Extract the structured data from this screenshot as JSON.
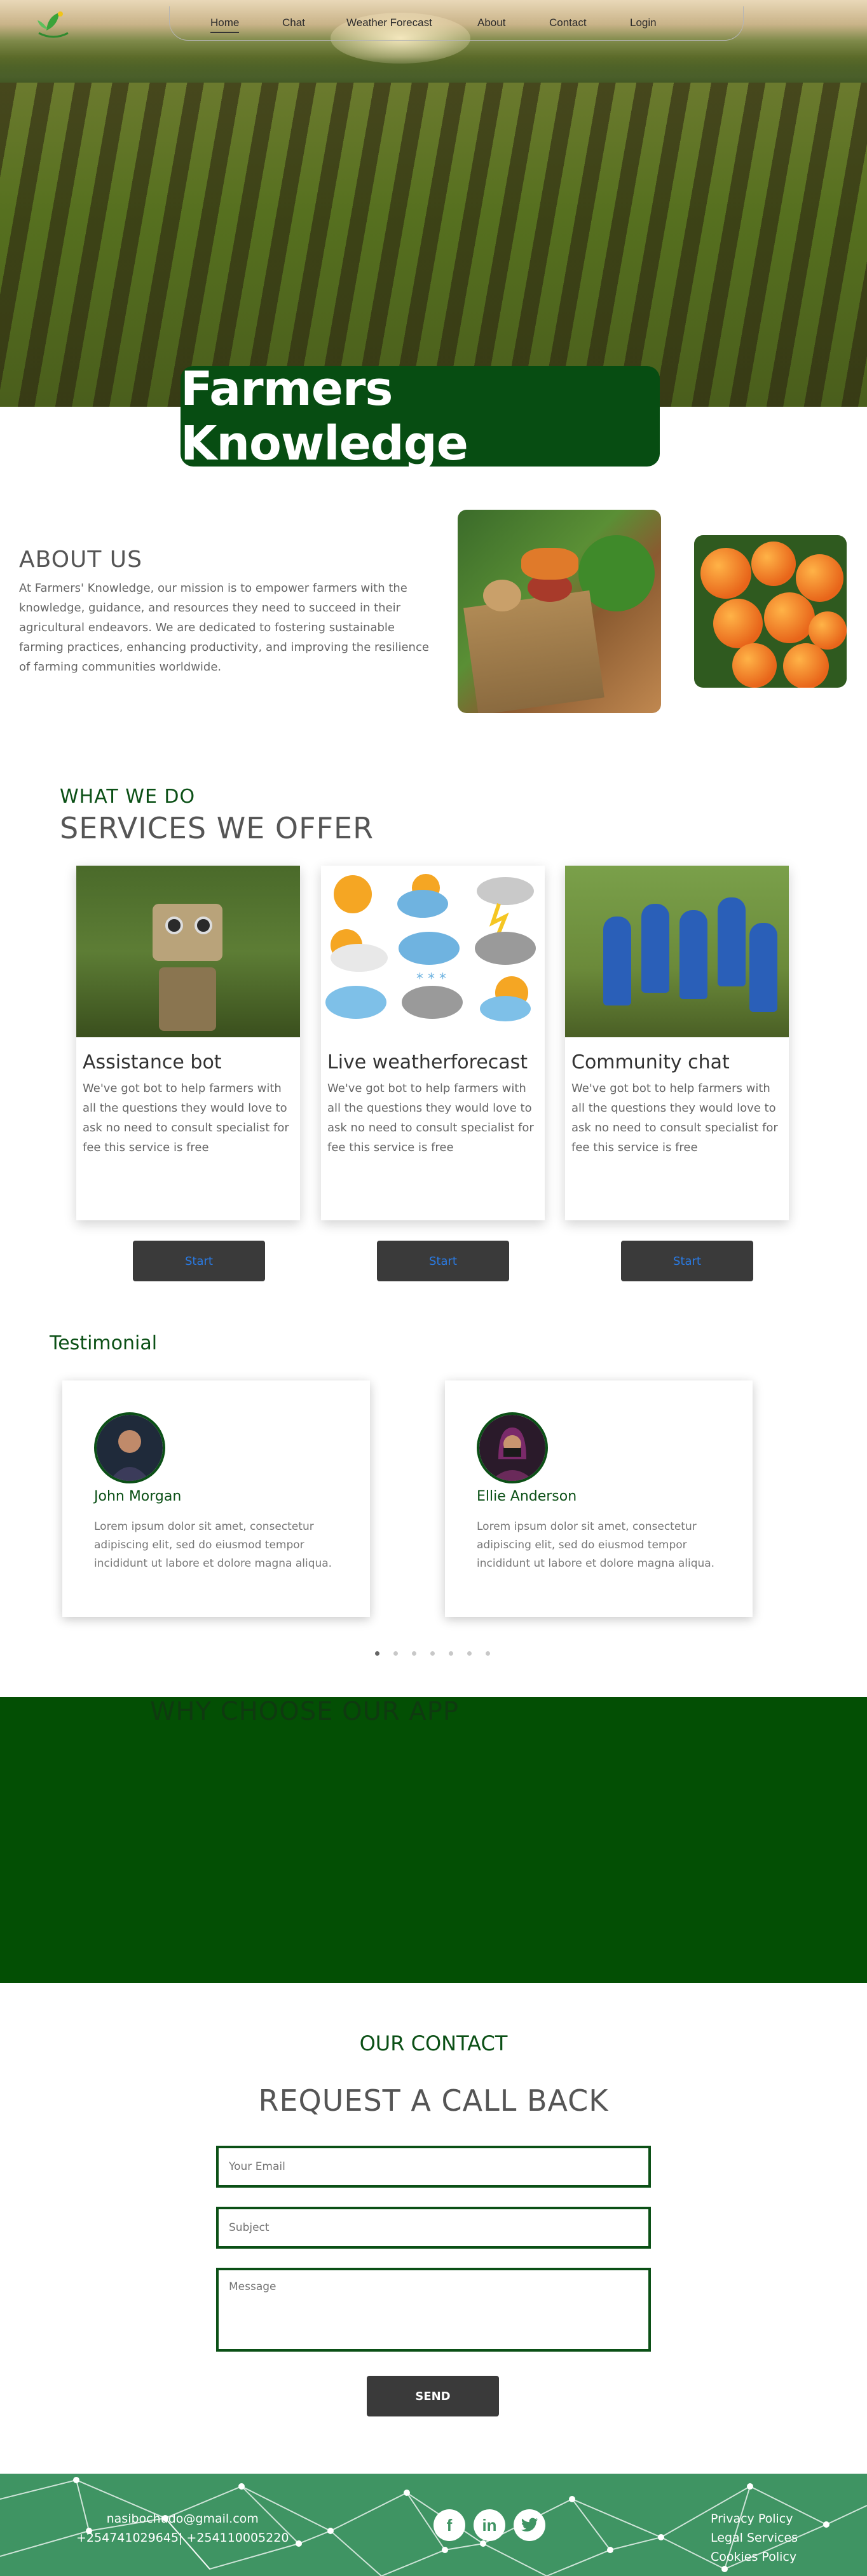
{
  "nav": {
    "items": [
      "Home",
      "Chat",
      "Weather Forecast",
      "About",
      "Contact",
      "Login"
    ],
    "active": "Home"
  },
  "hero": {
    "title": "Farmers Knowledge"
  },
  "about": {
    "heading": "ABOUT US",
    "text": "At Farmers' Knowledge, our mission is to empower farmers with the knowledge, guidance, and resources they need to succeed in their agricultural endeavors. We are dedicated to fostering sustainable farming practices, enhancing productivity, and improving the resilience of farming communities worldwide."
  },
  "services": {
    "kicker": "WHAT WE DO",
    "heading": "SERVICES WE OFFER",
    "cards": [
      {
        "title": "Assistance bot",
        "text": "We've got bot to help farmers with all the questions they would love to ask no need to consult specialist for fee this service is free",
        "button": "Start"
      },
      {
        "title": "Live weatherforecast",
        "text": "We've got bot to help farmers with all the questions they would love to ask no need to consult specialist for fee this service is free",
        "button": "Start"
      },
      {
        "title": "Community chat",
        "text": "We've got bot to help farmers with all the questions they would love to ask no need to consult specialist for fee this service is free",
        "button": "Start"
      }
    ]
  },
  "testimonial": {
    "heading": "Testimonial",
    "items": [
      {
        "name": "John Morgan",
        "text": "Lorem ipsum dolor sit amet, consectetur adipiscing elit, sed do eiusmod tempor incididunt ut labore et dolore magna aliqua."
      },
      {
        "name": "Ellie Anderson",
        "text": "Lorem ipsum dolor sit amet, consectetur adipiscing elit, sed do eiusmod tempor incididunt ut labore et dolore magna aliqua."
      }
    ],
    "dots_total": 7,
    "dots_active": 1
  },
  "why": {
    "heading": "WHY CHOOSE OUR APP"
  },
  "contact": {
    "kicker": "OUR CONTACT",
    "heading": "REQUEST A CALL BACK",
    "email_placeholder": "Your Email",
    "subject_placeholder": "Subject",
    "message_placeholder": "Message",
    "send": "SEND"
  },
  "footer": {
    "email": "nasibochudo@gmail.com",
    "phones": "+254741029645| +254110005220",
    "social": [
      "facebook-icon",
      "linkedin-icon",
      "twitter-icon"
    ],
    "links": [
      "Privacy Policy",
      "Legal Services",
      "Cookies Policy"
    ]
  },
  "colors": {
    "brand_green": "#074d12",
    "why_bg": "#034f04",
    "footer_bg": "#3f9463",
    "button_dark": "#3a3a3a",
    "button_text_blue": "#2a7ae2"
  }
}
